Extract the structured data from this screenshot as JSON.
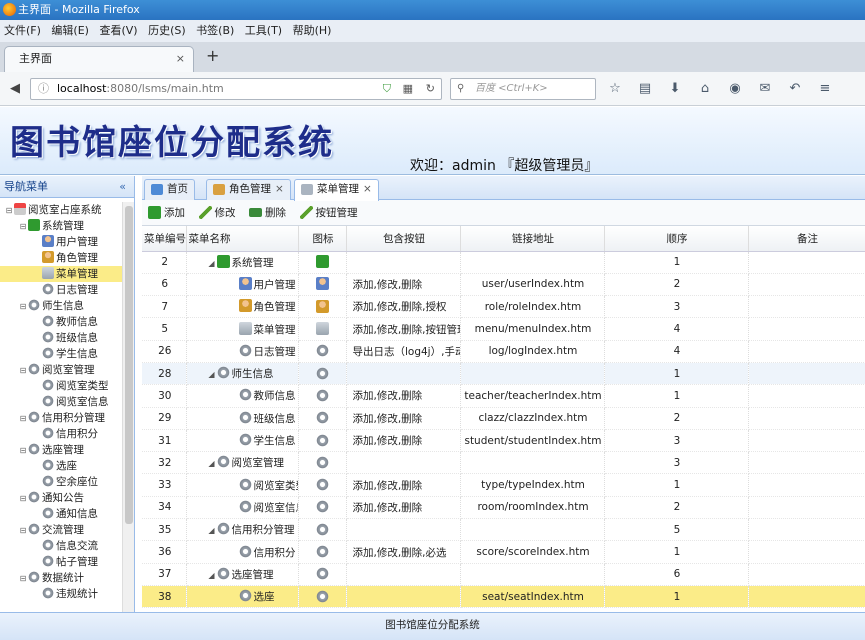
{
  "window": {
    "title": "主界面 - Mozilla Firefox"
  },
  "menubar": [
    "文件(F)",
    "编辑(E)",
    "查看(V)",
    "历史(S)",
    "书签(B)",
    "工具(T)",
    "帮助(H)"
  ],
  "browser_tab": {
    "label": "主界面",
    "close": "×",
    "new_tab": "+"
  },
  "url": {
    "host": "localhost",
    "rest": ":8080/lsms/main.htm"
  },
  "search": {
    "placeholder": "百度 <Ctrl+K>"
  },
  "banner": {
    "title": "图书馆座位分配系统",
    "welcome": "欢迎：admin 『超级管理员』"
  },
  "sidebar": {
    "title": "导航菜单",
    "collapse": "«",
    "tree": [
      {
        "label": "阅览室占座系统",
        "level": 0,
        "toggle": "⊟",
        "icon": "house"
      },
      {
        "label": "系统管理",
        "level": 1,
        "toggle": "⊟",
        "icon": "green"
      },
      {
        "label": "用户管理",
        "level": 2,
        "toggle": "",
        "icon": "user"
      },
      {
        "label": "角色管理",
        "level": 2,
        "toggle": "",
        "icon": "role"
      },
      {
        "label": "菜单管理",
        "level": 2,
        "toggle": "",
        "icon": "menu",
        "selected": true
      },
      {
        "label": "日志管理",
        "level": 2,
        "toggle": "",
        "icon": "gear"
      },
      {
        "label": "师生信息",
        "level": 1,
        "toggle": "⊟",
        "icon": "gear"
      },
      {
        "label": "教师信息",
        "level": 2,
        "toggle": "",
        "icon": "gear"
      },
      {
        "label": "班级信息",
        "level": 2,
        "toggle": "",
        "icon": "gear"
      },
      {
        "label": "学生信息",
        "level": 2,
        "toggle": "",
        "icon": "gear"
      },
      {
        "label": "阅览室管理",
        "level": 1,
        "toggle": "⊟",
        "icon": "gear"
      },
      {
        "label": "阅览室类型",
        "level": 2,
        "toggle": "",
        "icon": "gear"
      },
      {
        "label": "阅览室信息",
        "level": 2,
        "toggle": "",
        "icon": "gear"
      },
      {
        "label": "信用积分管理",
        "level": 1,
        "toggle": "⊟",
        "icon": "gear"
      },
      {
        "label": "信用积分",
        "level": 2,
        "toggle": "",
        "icon": "gear"
      },
      {
        "label": "选座管理",
        "level": 1,
        "toggle": "⊟",
        "icon": "gear"
      },
      {
        "label": "选座",
        "level": 2,
        "toggle": "",
        "icon": "gear"
      },
      {
        "label": "空余座位",
        "level": 2,
        "toggle": "",
        "icon": "gear"
      },
      {
        "label": "通知公告",
        "level": 1,
        "toggle": "⊟",
        "icon": "gear"
      },
      {
        "label": "通知信息",
        "level": 2,
        "toggle": "",
        "icon": "gear"
      },
      {
        "label": "交流管理",
        "level": 1,
        "toggle": "⊟",
        "icon": "gear"
      },
      {
        "label": "信息交流",
        "level": 2,
        "toggle": "",
        "icon": "gear"
      },
      {
        "label": "帖子管理",
        "level": 2,
        "toggle": "",
        "icon": "gear"
      },
      {
        "label": "数据统计",
        "level": 1,
        "toggle": "⊟",
        "icon": "gear"
      },
      {
        "label": "违规统计",
        "level": 2,
        "toggle": "",
        "icon": "gear"
      }
    ]
  },
  "content_tabs": [
    {
      "label": "首页",
      "close": "",
      "icon": "home-icon",
      "active": false
    },
    {
      "label": "角色管理",
      "close": "×",
      "icon": "role-icon",
      "active": false
    },
    {
      "label": "菜单管理",
      "close": "×",
      "icon": "menu-icon",
      "active": true
    }
  ],
  "toolbar": {
    "add": "添加",
    "edit": "修改",
    "delete": "删除",
    "button_manage": "按钮管理"
  },
  "table": {
    "headers": [
      "菜单编号",
      "菜单名称",
      "图标",
      "包含按钮",
      "链接地址",
      "顺序",
      "备注"
    ],
    "rows": [
      {
        "id": "2",
        "name": "系统管理",
        "depth": 0,
        "toggle": "◢",
        "icon": "green",
        "buttons": "",
        "url": "",
        "order": "1",
        "note": ""
      },
      {
        "id": "6",
        "name": "用户管理",
        "depth": 1,
        "toggle": "",
        "icon": "user",
        "buttons": "添加,修改,删除",
        "url": "user/userIndex.htm",
        "order": "2",
        "note": ""
      },
      {
        "id": "7",
        "name": "角色管理",
        "depth": 1,
        "toggle": "",
        "icon": "role",
        "buttons": "添加,修改,删除,授权",
        "url": "role/roleIndex.htm",
        "order": "3",
        "note": ""
      },
      {
        "id": "5",
        "name": "菜单管理",
        "depth": 1,
        "toggle": "",
        "icon": "menu",
        "buttons": "添加,修改,删除,按钮管理",
        "url": "menu/menuIndex.htm",
        "order": "4",
        "note": ""
      },
      {
        "id": "26",
        "name": "日志管理",
        "depth": 1,
        "toggle": "",
        "icon": "gear",
        "buttons": "导出日志（log4j）,手动",
        "url": "log/logIndex.htm",
        "order": "4",
        "note": ""
      },
      {
        "id": "28",
        "name": "师生信息",
        "depth": 0,
        "toggle": "◢",
        "icon": "gear",
        "buttons": "",
        "url": "",
        "order": "1",
        "note": "",
        "hl": true
      },
      {
        "id": "30",
        "name": "教师信息",
        "depth": 1,
        "toggle": "",
        "icon": "gear",
        "buttons": "添加,修改,删除",
        "url": "teacher/teacherIndex.htm",
        "order": "1",
        "note": ""
      },
      {
        "id": "29",
        "name": "班级信息",
        "depth": 1,
        "toggle": "",
        "icon": "gear",
        "buttons": "添加,修改,删除",
        "url": "clazz/clazzIndex.htm",
        "order": "2",
        "note": ""
      },
      {
        "id": "31",
        "name": "学生信息",
        "depth": 1,
        "toggle": "",
        "icon": "gear",
        "buttons": "添加,修改,删除",
        "url": "student/studentIndex.htm",
        "order": "3",
        "note": ""
      },
      {
        "id": "32",
        "name": "阅览室管理",
        "depth": 0,
        "toggle": "◢",
        "icon": "gear",
        "buttons": "",
        "url": "",
        "order": "3",
        "note": ""
      },
      {
        "id": "33",
        "name": "阅览室类型",
        "depth": 1,
        "toggle": "",
        "icon": "gear",
        "buttons": "添加,修改,删除",
        "url": "type/typeIndex.htm",
        "order": "1",
        "note": ""
      },
      {
        "id": "34",
        "name": "阅览室信息",
        "depth": 1,
        "toggle": "",
        "icon": "gear",
        "buttons": "添加,修改,删除",
        "url": "room/roomIndex.htm",
        "order": "2",
        "note": ""
      },
      {
        "id": "35",
        "name": "信用积分管理",
        "depth": 0,
        "toggle": "◢",
        "icon": "gear",
        "buttons": "",
        "url": "",
        "order": "5",
        "note": ""
      },
      {
        "id": "36",
        "name": "信用积分",
        "depth": 1,
        "toggle": "",
        "icon": "gear",
        "buttons": "添加,修改,删除,必选",
        "url": "score/scoreIndex.htm",
        "order": "1",
        "note": ""
      },
      {
        "id": "37",
        "name": "选座管理",
        "depth": 0,
        "toggle": "◢",
        "icon": "gear",
        "buttons": "",
        "url": "",
        "order": "6",
        "note": ""
      },
      {
        "id": "38",
        "name": "选座",
        "depth": 1,
        "toggle": "",
        "icon": "gear",
        "buttons": "",
        "url": "seat/seatIndex.htm",
        "order": "1",
        "note": "",
        "sel": true
      }
    ]
  },
  "footer": "图书馆座位分配系统",
  "colors": {
    "accent": "#15428b",
    "selected": "#fbec88",
    "header_blue": "#99bbe8"
  }
}
